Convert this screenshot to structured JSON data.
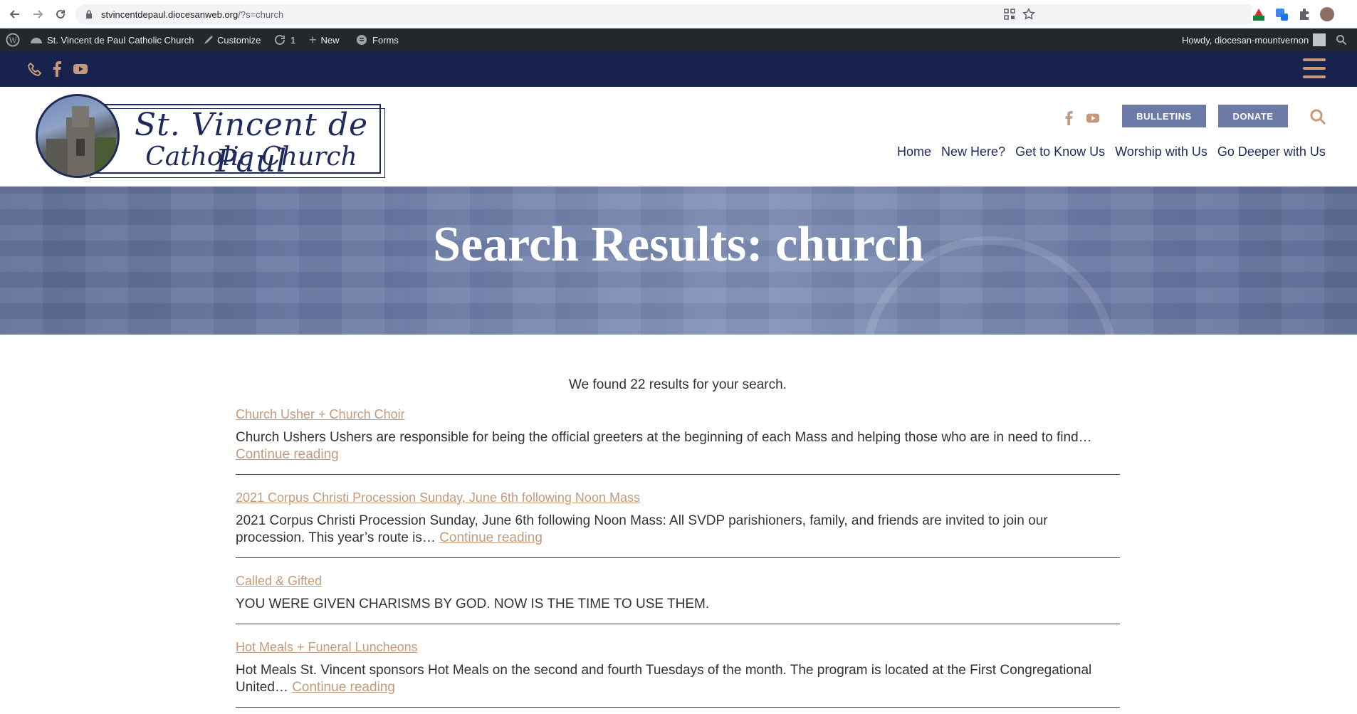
{
  "browser": {
    "url_domain": "stvincentdepaul.diocesanweb.org",
    "url_path": "/?s=church"
  },
  "admin_bar": {
    "site_name": "St. Vincent de Paul Catholic Church",
    "customize": "Customize",
    "updates_count": "1",
    "new": "New",
    "forms": "Forms",
    "howdy": "Howdy, diocesan-mountvernon"
  },
  "header": {
    "logo_line1": "St. Vincent de Paul",
    "logo_line2": "Catholic Church",
    "bulletins": "BULLETINS",
    "donate": "DONATE",
    "nav": [
      "Home",
      "New Here?",
      "Get to Know Us",
      "Worship with Us",
      "Go Deeper with Us"
    ]
  },
  "hero": {
    "title": "Search Results: church"
  },
  "results": {
    "summary": "We found 22 results for your search.",
    "items": [
      {
        "title": "Church Usher + Church Choir",
        "excerpt": "Church Ushers Ushers are responsible for being the official greeters at the beginning of each Mass and helping those who are in need to find…",
        "more": "Continue reading"
      },
      {
        "title": "2021 Corpus Christi Procession Sunday, June 6th following Noon Mass",
        "excerpt": "2021 Corpus Christi Procession Sunday, June 6th following Noon Mass: All SVDP parishioners, family, and friends are invited to join our procession. This year’s route is…",
        "more": "Continue reading"
      },
      {
        "title": "Called & Gifted",
        "excerpt": "YOU WERE GIVEN CHARISMS BY GOD. NOW IS THE TIME TO USE THEM.",
        "more": ""
      },
      {
        "title": "Hot Meals + Funeral Luncheons",
        "excerpt": "Hot Meals St. Vincent sponsors Hot Meals on the second and fourth Tuesdays of the month. The program is located at the First Congregational United…",
        "more": "Continue reading"
      }
    ]
  },
  "colors": {
    "navy": "#18234d",
    "accent": "#c49a7a",
    "button": "#6b7aa6",
    "hero": "#6a7aa4"
  }
}
